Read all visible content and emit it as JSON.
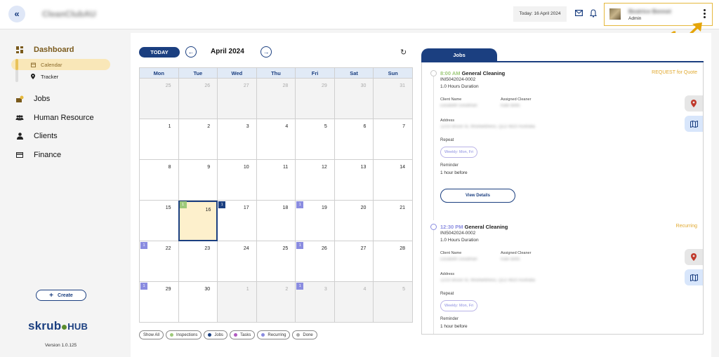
{
  "header": {
    "app_name": "CleanClubAU",
    "today_text": "Today: 16 April 2024",
    "user_name": "Beatrice Bennet",
    "user_role": "Admin",
    "annotation_number": "1"
  },
  "sidebar": {
    "dashboard": "Dashboard",
    "calendar": "Calendar",
    "tracker": "Tracker",
    "jobs": "Jobs",
    "human_resource": "Human Resource",
    "clients": "Clients",
    "finance": "Finance",
    "create": "Create",
    "logo_text": "skrub",
    "logo_hub": "HUB",
    "version": "Version 1.0.125"
  },
  "calendar": {
    "today_label": "TODAY",
    "month": "April 2024",
    "weekdays": [
      "Mon",
      "Tue",
      "Wed",
      "Thu",
      "Fri",
      "Sat",
      "Sun"
    ],
    "weeks": [
      [
        {
          "d": "25",
          "o": true
        },
        {
          "d": "26",
          "o": true
        },
        {
          "d": "27",
          "o": true
        },
        {
          "d": "28",
          "o": true
        },
        {
          "d": "29",
          "o": true
        },
        {
          "d": "30",
          "o": true
        },
        {
          "d": "31",
          "o": true
        }
      ],
      [
        {
          "d": "1"
        },
        {
          "d": "2"
        },
        {
          "d": "3"
        },
        {
          "d": "4"
        },
        {
          "d": "5"
        },
        {
          "d": "6"
        },
        {
          "d": "7"
        }
      ],
      [
        {
          "d": "8"
        },
        {
          "d": "9"
        },
        {
          "d": "10"
        },
        {
          "d": "11"
        },
        {
          "d": "12"
        },
        {
          "d": "13"
        },
        {
          "d": "14"
        }
      ],
      [
        {
          "d": "15"
        },
        {
          "d": "16",
          "today": true,
          "badge": "1",
          "bt": "inspection"
        },
        {
          "d": "17",
          "badge": "1",
          "bt": "jobs"
        },
        {
          "d": "18"
        },
        {
          "d": "19",
          "badge": "1",
          "bt": "recurring"
        },
        {
          "d": "20"
        },
        {
          "d": "21"
        }
      ],
      [
        {
          "d": "22",
          "badge": "1",
          "bt": "recurring"
        },
        {
          "d": "23"
        },
        {
          "d": "24"
        },
        {
          "d": "25"
        },
        {
          "d": "26",
          "badge": "1",
          "bt": "recurring"
        },
        {
          "d": "27"
        },
        {
          "d": "28"
        }
      ],
      [
        {
          "d": "29",
          "badge": "1",
          "bt": "recurring"
        },
        {
          "d": "30"
        },
        {
          "d": "1",
          "o": true
        },
        {
          "d": "2",
          "o": true
        },
        {
          "d": "3",
          "o": true,
          "badge": "1",
          "bt": "recurring"
        },
        {
          "d": "4",
          "o": true
        },
        {
          "d": "5",
          "o": true
        }
      ]
    ],
    "legend": [
      {
        "label": "Show All",
        "color": ""
      },
      {
        "label": "Inspections",
        "color": "#9dc97a"
      },
      {
        "label": "Jobs",
        "color": "#1b3f80"
      },
      {
        "label": "Tasks",
        "color": "#b05ac0"
      },
      {
        "label": "Recurring",
        "color": "#8a8ce0"
      },
      {
        "label": "Done",
        "color": "#aaaaaa"
      }
    ]
  },
  "jobs_panel": {
    "tab_label": "Jobs",
    "jobs": [
      {
        "time": "8:00 AM",
        "title": "General Cleaning",
        "id": "INI5042024-0002",
        "duration": "1.0 Hours Duration",
        "status": "REQUEST for Quote",
        "client_name_label": "Client Name",
        "client_name": "Elizabeth Goodman",
        "assigned_label": "Assigned Cleaner",
        "assigned": "Kate Betts",
        "address_label": "Address",
        "address": "12/10 Bruce St, Woolwellness, QLD 4820 Australia",
        "repeat_label": "Repeat",
        "repeat": "Weekly: Mon, Fri",
        "reminder_label": "Reminder",
        "reminder": "1 hour before",
        "view_details": "View Details"
      },
      {
        "time": "12:30 PM",
        "title": "General Cleaning",
        "id": "INI5042024-0002",
        "duration": "1.0 Hours Duration",
        "status": "Recurring",
        "client_name_label": "Client Name",
        "client_name": "Elizabeth Goodman",
        "assigned_label": "Assigned Cleaner",
        "assigned": "Kate Betts",
        "address_label": "Address",
        "address": "12/10 Bruce St, Woolwellness, QLD 4820 Australia",
        "repeat_label": "Repeat",
        "repeat": "Weekly: Mon, Fri",
        "reminder_label": "Reminder",
        "reminder": "1 hour before",
        "view_details": "View Details"
      }
    ]
  }
}
